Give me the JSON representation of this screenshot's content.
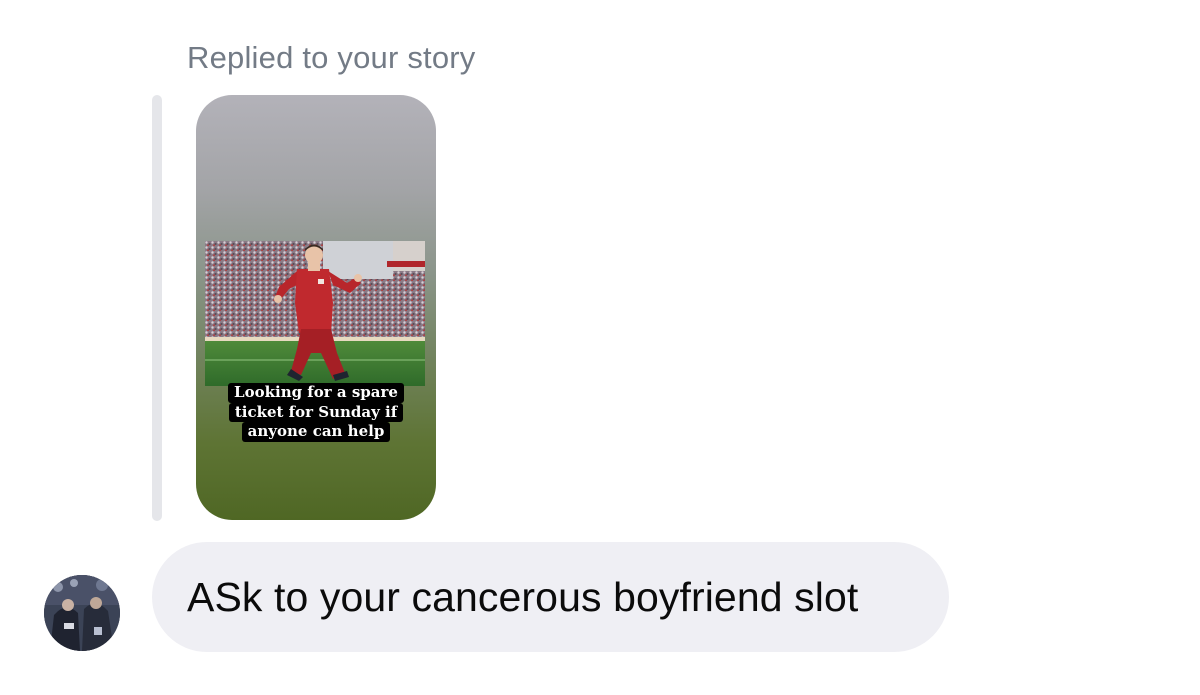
{
  "reply_header": {
    "label": "Replied to your story"
  },
  "story": {
    "image_icon": "footballer-celebrating-photo",
    "caption_lines": [
      "Looking for a spare",
      "ticket for Sunday if",
      "anyone can help"
    ]
  },
  "message": {
    "sender_avatar_icon": "user-avatar-photo",
    "text": "ASk to your cancerous boyfriend slot"
  },
  "colors": {
    "bubble_background": "#efeff4",
    "reply_bar": "#e5e6ea",
    "label_text": "#737b86",
    "message_text": "#0b0b0b"
  }
}
